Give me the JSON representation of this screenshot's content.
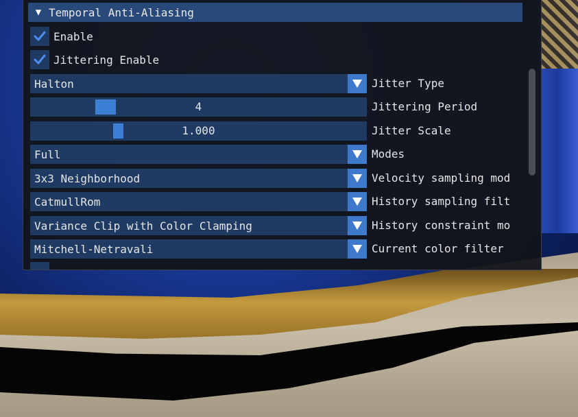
{
  "panel": {
    "header": {
      "title": "Temporal Anti-Aliasing",
      "expanded": true
    },
    "checkboxes": [
      {
        "label": "Enable",
        "checked": true
      },
      {
        "label": "Jittering Enable",
        "checked": true
      }
    ],
    "jitter_type": {
      "value": "Halton",
      "label": "Jitter Type"
    },
    "jittering_period": {
      "value": "4",
      "label": "Jittering Period"
    },
    "jitter_scale": {
      "value": "1.000",
      "label": "Jitter Scale"
    },
    "modes": {
      "value": "Full",
      "label": "Modes"
    },
    "velocity_sampling": {
      "value": "3x3 Neighborhood",
      "label": "Velocity sampling mod"
    },
    "history_sampling": {
      "value": "CatmullRom",
      "label": "History sampling filt"
    },
    "history_constraint": {
      "value": "Variance Clip with Color Clamping",
      "label": "History constraint mo"
    },
    "current_color_filter": {
      "value": "Mitchell-Netravali",
      "label": "Current color filter"
    }
  },
  "colors": {
    "frame_bg": "#1f3b63",
    "header_bg": "#28497a",
    "accent": "#3e79cc",
    "check": "#4a8ef0"
  },
  "icons": [
    "tree-expanded-arrow-icon",
    "checkmark-icon",
    "combo-arrow-down-icon"
  ]
}
